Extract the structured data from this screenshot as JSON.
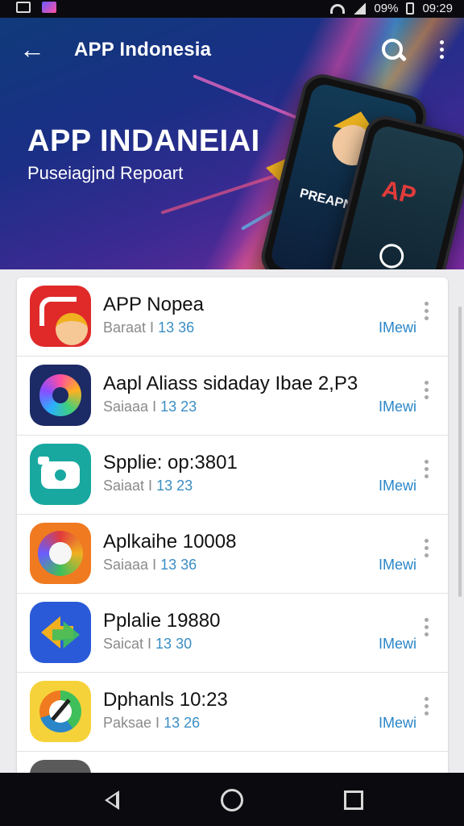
{
  "status_bar": {
    "battery_text": "09%",
    "time": "09:29"
  },
  "header": {
    "title": "APP Indonesia"
  },
  "banner": {
    "title": "APP INDANEIAI",
    "subtitle": "Puseiagjnd Repoart",
    "phone1_text": "PREAPN",
    "phone2_text": "AP"
  },
  "apps": [
    {
      "name": "APP Nopea",
      "meta_label": "Baraat",
      "meta_sep": " I ",
      "meta_num": "13 36",
      "action": "IMewi",
      "icon": "fortune-girl-icon"
    },
    {
      "name": "Aapl Aliass sidaday Ibae 2,P3",
      "meta_label": "Saiaaa",
      "meta_sep": " I ",
      "meta_num": "13 23",
      "action": "IMewi",
      "icon": "palette-icon"
    },
    {
      "name": "Spplie: op:3801",
      "meta_label": "Saiaat",
      "meta_sep": " I ",
      "meta_num": "13 23",
      "action": "IMewi",
      "icon": "camera-icon"
    },
    {
      "name": "Aplkaihe 10008",
      "meta_label": "Saiaaa",
      "meta_sep": " I ",
      "meta_num": "13 36",
      "action": "IMewi",
      "icon": "swirl-icon"
    },
    {
      "name": "Pplalie 19880",
      "meta_label": "Saicat",
      "meta_sep": " I ",
      "meta_num": "13 30",
      "action": "IMewi",
      "icon": "arrows-icon"
    },
    {
      "name": "Dphanls 10:23",
      "meta_label": "Paksae",
      "meta_sep": " I ",
      "meta_num": "13 26",
      "action": "IMewi",
      "icon": "gauge-icon"
    }
  ],
  "colors": {
    "accent": "#2a86c8",
    "header_bg": "#1a2f86"
  }
}
